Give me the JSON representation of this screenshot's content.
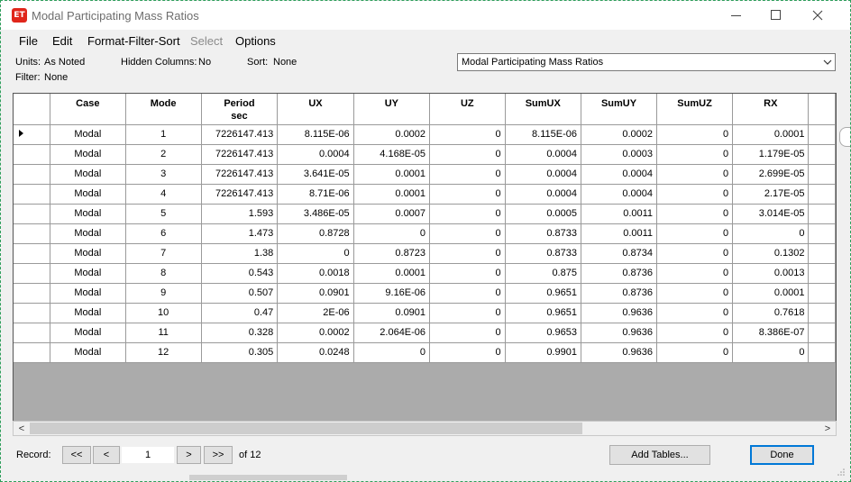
{
  "window": {
    "app_icon_text": "ET",
    "title": "Modal Participating Mass Ratios"
  },
  "menu": {
    "file": "File",
    "edit": "Edit",
    "format": "Format-Filter-Sort",
    "select": "Select",
    "options": "Options"
  },
  "info": {
    "units_label": "Units:",
    "units_value": "As Noted",
    "hidden_label": "Hidden Columns:",
    "hidden_value": "No",
    "sort_label": "Sort:",
    "sort_value": "None",
    "filter_label": "Filter:",
    "filter_value": "None"
  },
  "table_selector": {
    "selected": "Modal Participating Mass Ratios"
  },
  "grid": {
    "columns": [
      {
        "line1": "Case",
        "line2": ""
      },
      {
        "line1": "Mode",
        "line2": ""
      },
      {
        "line1": "Period",
        "line2": "sec"
      },
      {
        "line1": "UX",
        "line2": ""
      },
      {
        "line1": "UY",
        "line2": ""
      },
      {
        "line1": "UZ",
        "line2": ""
      },
      {
        "line1": "SumUX",
        "line2": ""
      },
      {
        "line1": "SumUY",
        "line2": ""
      },
      {
        "line1": "SumUZ",
        "line2": ""
      },
      {
        "line1": "RX",
        "line2": ""
      }
    ],
    "rows": [
      [
        "Modal",
        "1",
        "7226147.413",
        "8.115E-06",
        "0.0002",
        "0",
        "8.115E-06",
        "0.0002",
        "0",
        "0.0001"
      ],
      [
        "Modal",
        "2",
        "7226147.413",
        "0.0004",
        "4.168E-05",
        "0",
        "0.0004",
        "0.0003",
        "0",
        "1.179E-05"
      ],
      [
        "Modal",
        "3",
        "7226147.413",
        "3.641E-05",
        "0.0001",
        "0",
        "0.0004",
        "0.0004",
        "0",
        "2.699E-05"
      ],
      [
        "Modal",
        "4",
        "7226147.413",
        "8.71E-06",
        "0.0001",
        "0",
        "0.0004",
        "0.0004",
        "0",
        "2.17E-05"
      ],
      [
        "Modal",
        "5",
        "1.593",
        "3.486E-05",
        "0.0007",
        "0",
        "0.0005",
        "0.0011",
        "0",
        "3.014E-05"
      ],
      [
        "Modal",
        "6",
        "1.473",
        "0.8728",
        "0",
        "0",
        "0.8733",
        "0.0011",
        "0",
        "0"
      ],
      [
        "Modal",
        "7",
        "1.38",
        "0",
        "0.8723",
        "0",
        "0.8733",
        "0.8734",
        "0",
        "0.1302"
      ],
      [
        "Modal",
        "8",
        "0.543",
        "0.0018",
        "0.0001",
        "0",
        "0.875",
        "0.8736",
        "0",
        "0.0013"
      ],
      [
        "Modal",
        "9",
        "0.507",
        "0.0901",
        "9.16E-06",
        "0",
        "0.9651",
        "0.8736",
        "0",
        "0.0001"
      ],
      [
        "Modal",
        "10",
        "0.47",
        "2E-06",
        "0.0901",
        "0",
        "0.9651",
        "0.9636",
        "0",
        "0.7618"
      ],
      [
        "Modal",
        "11",
        "0.328",
        "0.0002",
        "2.064E-06",
        "0",
        "0.9653",
        "0.9636",
        "0",
        "8.386E-07"
      ],
      [
        "Modal",
        "12",
        "0.305",
        "0.0248",
        "0",
        "0",
        "0.9901",
        "0.9636",
        "0",
        "0"
      ]
    ]
  },
  "footer": {
    "record_label": "Record:",
    "first": "<<",
    "prev": "<",
    "record_value": "1",
    "next": ">",
    "last": ">>",
    "of_text": "of 12",
    "add_tables": "Add Tables...",
    "done": "Done"
  },
  "scrollbar": {
    "left_arrow": "<",
    "right_arrow": ">"
  }
}
